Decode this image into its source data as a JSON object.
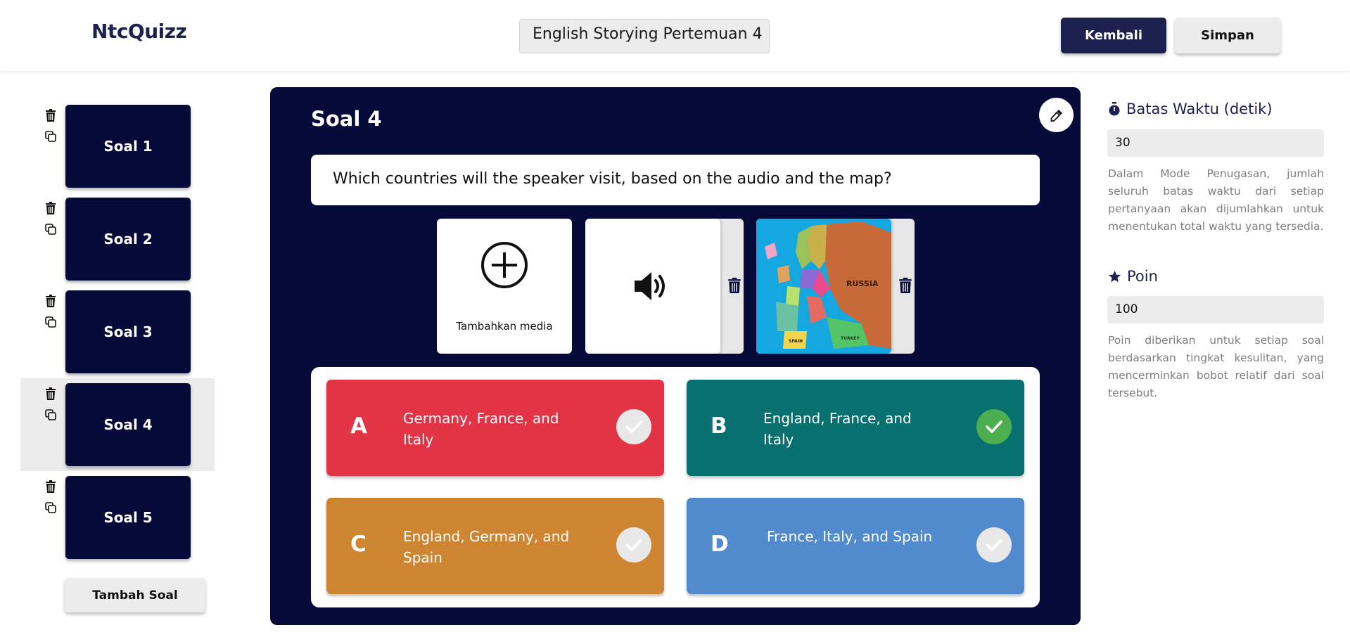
{
  "header": {
    "logo": "NtcQuizz",
    "quiz_title": "English Storying Pertemuan 4",
    "back_label": "Kembali",
    "save_label": "Simpan"
  },
  "sidebar": {
    "questions": [
      {
        "label": "Soal 1"
      },
      {
        "label": "Soal 2"
      },
      {
        "label": "Soal 3"
      },
      {
        "label": "Soal 4"
      },
      {
        "label": "Soal 5"
      }
    ],
    "active_index": 3,
    "add_label": "Tambah Soal"
  },
  "editor": {
    "title": "Soal 4",
    "question": "Which countries will the speaker visit, based on the audio and the map?",
    "add_media_label": "Tambahkan media",
    "media": [
      {
        "type": "audio",
        "icon": "speaker-icon"
      },
      {
        "type": "image",
        "icon": "europe-map-image"
      }
    ],
    "map_labels": [
      "RUSSIA",
      "TURKEY",
      "SPAIN"
    ],
    "answers": [
      {
        "letter": "A",
        "text": "Germany, France, and Italy",
        "color": "#e23445",
        "correct": false
      },
      {
        "letter": "B",
        "text": "England, France, and Italy",
        "color": "#08706f",
        "correct": true
      },
      {
        "letter": "C",
        "text": "England, Germany, and Spain",
        "color": "#ce8531",
        "correct": false
      },
      {
        "letter": "D",
        "text": "France, Italy, and Spain",
        "color": "#528bcd",
        "correct": false
      }
    ]
  },
  "settings": {
    "time_label": "Batas Waktu (detik)",
    "time_value": "30",
    "time_desc": "Dalam Mode Penugasan, jumlah seluruh batas waktu dari setiap pertanyaan akan dijumlahkan untuk menentukan total waktu yang tersedia.",
    "points_label": "Poin",
    "points_value": "100",
    "points_desc": "Poin diberikan untuk setiap soal berdasarkan tingkat kesulitan, yang mencerminkan bobot relatif dari soal tersebut."
  },
  "colors": {
    "navy": "#050a38",
    "brand": "#1c2150",
    "correct_green": "#4cae4f"
  }
}
